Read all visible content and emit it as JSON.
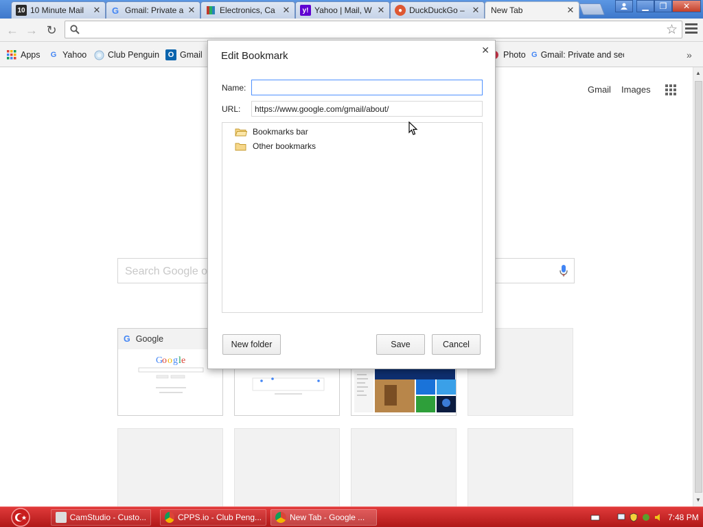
{
  "tabs": [
    {
      "title": "10 Minute Mail",
      "favicon": "ten-minute-mail-icon",
      "active": false
    },
    {
      "title": "Gmail: Private a",
      "favicon": "google-icon",
      "active": false
    },
    {
      "title": "Electronics, Ca",
      "favicon": "electronics-icon",
      "active": false
    },
    {
      "title": "Yahoo | Mail, W",
      "favicon": "yahoo-icon",
      "active": false
    },
    {
      "title": "DuckDuckGo –",
      "favicon": "duckduckgo-icon",
      "active": false
    },
    {
      "title": "New Tab",
      "favicon": "",
      "active": true
    }
  ],
  "omnibox": {
    "value": ""
  },
  "bookmarks": [
    {
      "label": "Apps",
      "icon": "apps-grid-icon"
    },
    {
      "label": "Yahoo",
      "icon": "google-icon"
    },
    {
      "label": "Club Penguin",
      "icon": "club-penguin-icon"
    },
    {
      "label": "Gmail",
      "icon": "outlook-icon"
    },
    {
      "label": "Photo",
      "icon": "photo-icon"
    },
    {
      "label": "Gmail: Private and sec",
      "icon": "google-icon"
    }
  ],
  "newtab": {
    "gmail_link": "Gmail",
    "images_link": "Images",
    "search_placeholder": "Search Google or",
    "tiles": [
      {
        "title": "Google"
      }
    ]
  },
  "dialog": {
    "title": "Edit Bookmark",
    "name_label": "Name:",
    "name_value": "",
    "url_label": "URL:",
    "url_value": "https://www.google.com/gmail/about/",
    "folders": [
      "Bookmarks bar",
      "Other bookmarks"
    ],
    "new_folder_label": "New folder",
    "save_label": "Save",
    "cancel_label": "Cancel"
  },
  "taskbar": {
    "items": [
      {
        "label": "CamStudio - Custo...",
        "icon": "camstudio-icon"
      },
      {
        "label": "CPPS.io - Club Peng...",
        "icon": "chrome-icon"
      },
      {
        "label": "New Tab - Google ...",
        "icon": "chrome-icon"
      }
    ],
    "clock": "7:48 PM"
  },
  "colors": {
    "tabstrip": "#3e78cb",
    "taskbar": "#c41f1f",
    "focus_border": "#4d90fe"
  }
}
